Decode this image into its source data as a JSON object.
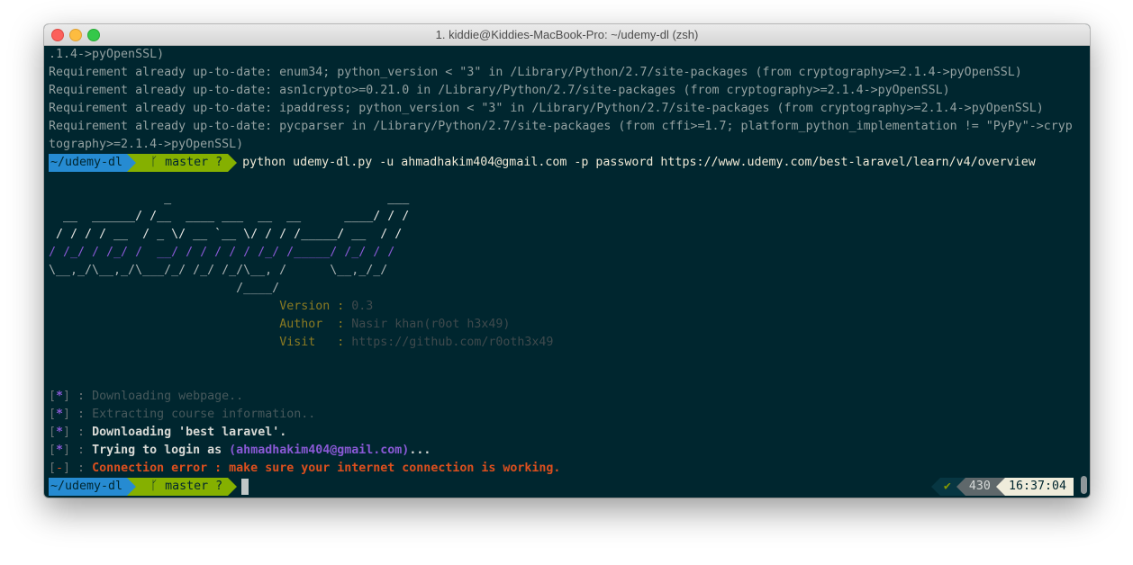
{
  "window": {
    "title": "1. kiddie@Kiddies-MacBook-Pro: ~/udemy-dl (zsh)"
  },
  "output_lines": [
    ".1.4->pyOpenSSL)",
    "Requirement already up-to-date: enum34; python_version < \"3\" in /Library/Python/2.7/site-packages (from cryptography>=2.1.4->pyOpenSSL)",
    "Requirement already up-to-date: asn1crypto>=0.21.0 in /Library/Python/2.7/site-packages (from cryptography>=2.1.4->pyOpenSSL)",
    "Requirement already up-to-date: ipaddress; python_version < \"3\" in /Library/Python/2.7/site-packages (from cryptography>=2.1.4->pyOpenSSL)",
    "Requirement already up-to-date: pycparser in /Library/Python/2.7/site-packages (from cffi>=1.7; platform_python_implementation != \"PyPy\"->cryp",
    "tography>=2.1.4->pyOpenSSL)"
  ],
  "prompt": {
    "dir": "~/udemy-dl",
    "git_icon": "ᚴ",
    "branch": "master ?",
    "command": "python udemy-dl.py -u ahmadhakim404@gmail.com -p password https://www.udemy.com/best-laravel/learn/v4/overview"
  },
  "banner": {
    "lines": [
      "                _                              ___",
      "  __  ______/ /__  ____ ___  __  __      ____/ / /",
      " / / / / __  / _ \\/ __ `__ \\/ / / /_____/ __  / /",
      "/ /_/ / /_/ /  __/ / / / / / /_/ /_____/ /_/ / /",
      "\\__,_/\\__,_/\\___/_/ /_/ /_/\\__, /      \\__,_/_/",
      "                          /____/"
    ],
    "info": [
      {
        "key": "Version",
        "value": "0.3"
      },
      {
        "key": "Author ",
        "value": "Nasir khan(r0ot h3x49)"
      },
      {
        "key": "Visit  ",
        "value": "https://github.com/r0oth3x49"
      }
    ]
  },
  "status": {
    "downloading_webpage": "Downloading webpage..",
    "extracting": "Extracting course information..",
    "downloading_prefix": "Downloading ",
    "course_name": "'best laravel'",
    "downloading_suffix": ".",
    "login_prefix": "Trying to login as ",
    "login_email": "(ahmadhakim404@gmail.com)",
    "login_suffix": "...",
    "error_text": "Connection error : make sure your internet connection is working."
  },
  "right_prompt": {
    "status_icon": "✔",
    "history_number": "430",
    "time": "16:37:04"
  },
  "colors": {
    "background": "#00262f",
    "prompt_dir": "#268bd2",
    "prompt_git": "#85b000",
    "accent_purple": "#8a59d6",
    "error": "#dc4f1e"
  }
}
